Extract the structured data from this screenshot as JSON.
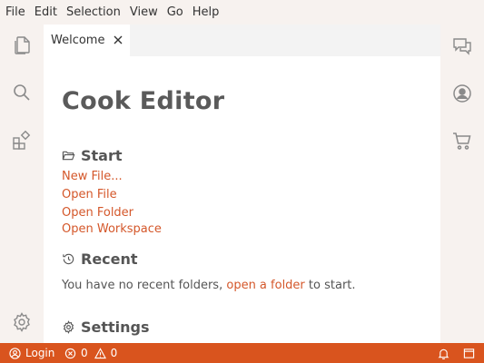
{
  "menubar": {
    "items": [
      "File",
      "Edit",
      "Selection",
      "View",
      "Go",
      "Help"
    ]
  },
  "activity_left": {
    "icons": [
      "files-icon",
      "search-icon",
      "extensions-icon",
      "settings-gear-icon"
    ]
  },
  "activity_right": {
    "icons": [
      "chat-icon",
      "account-icon",
      "cart-icon"
    ]
  },
  "tabs": [
    {
      "label": "Welcome",
      "active": true
    }
  ],
  "welcome": {
    "title": "Cook Editor",
    "start": {
      "heading": "Start",
      "links": [
        "New File...",
        "Open File",
        "Open Folder",
        "Open Workspace"
      ]
    },
    "recent": {
      "heading": "Recent",
      "text_before": "You have no recent folders,",
      "link": "open a folder",
      "text_after": "to start."
    },
    "settings": {
      "heading": "Settings"
    }
  },
  "statusbar": {
    "login_label": "Login",
    "errors": "0",
    "warnings": "0"
  },
  "colors": {
    "accent": "#d9541e",
    "link": "#d4572a",
    "sidebar_bg": "#f7f2ef"
  }
}
